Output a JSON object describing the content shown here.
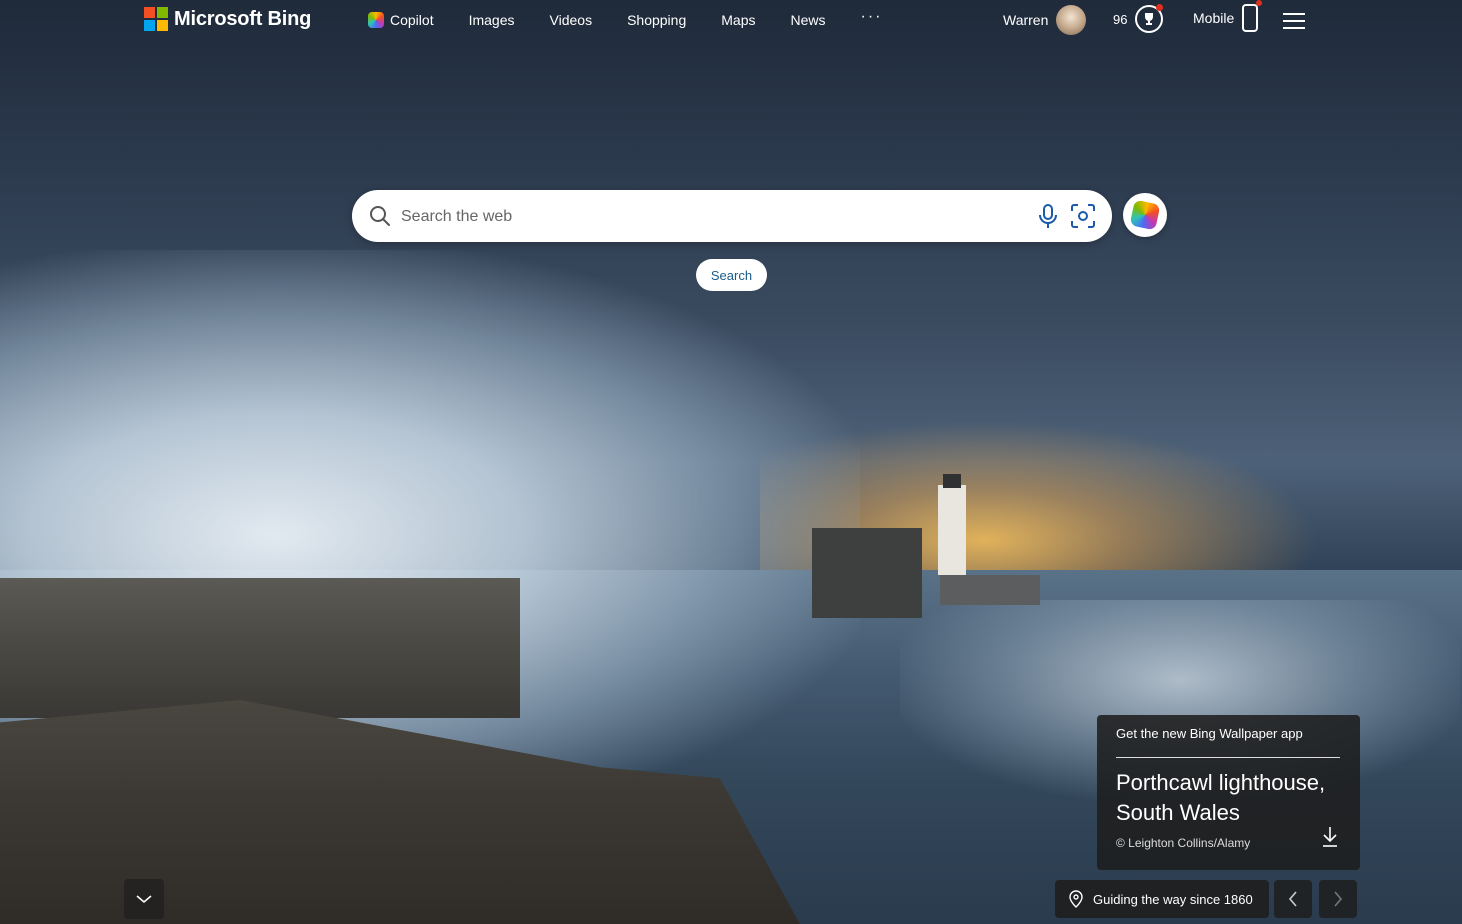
{
  "brand": {
    "name": "Microsoft Bing"
  },
  "nav": {
    "items": [
      {
        "label": "Copilot",
        "icon": "copilot-icon"
      },
      {
        "label": "Images"
      },
      {
        "label": "Videos"
      },
      {
        "label": "Shopping"
      },
      {
        "label": "Maps"
      },
      {
        "label": "News"
      }
    ],
    "more_label": "···"
  },
  "user": {
    "name": "Warren",
    "rewards_points": "96",
    "mobile_label": "Mobile"
  },
  "search": {
    "placeholder": "Search the web",
    "button_label": "Search"
  },
  "wallpaper": {
    "app_promo": "Get the new Bing Wallpaper app",
    "title": "Porthcawl lighthouse, South Wales",
    "credit": "© Leighton Collins/Alamy",
    "caption": "Guiding the way since 1860"
  },
  "colors": {
    "search_button_text": "#1a5a8a",
    "notification_dot": "#e0301e"
  }
}
